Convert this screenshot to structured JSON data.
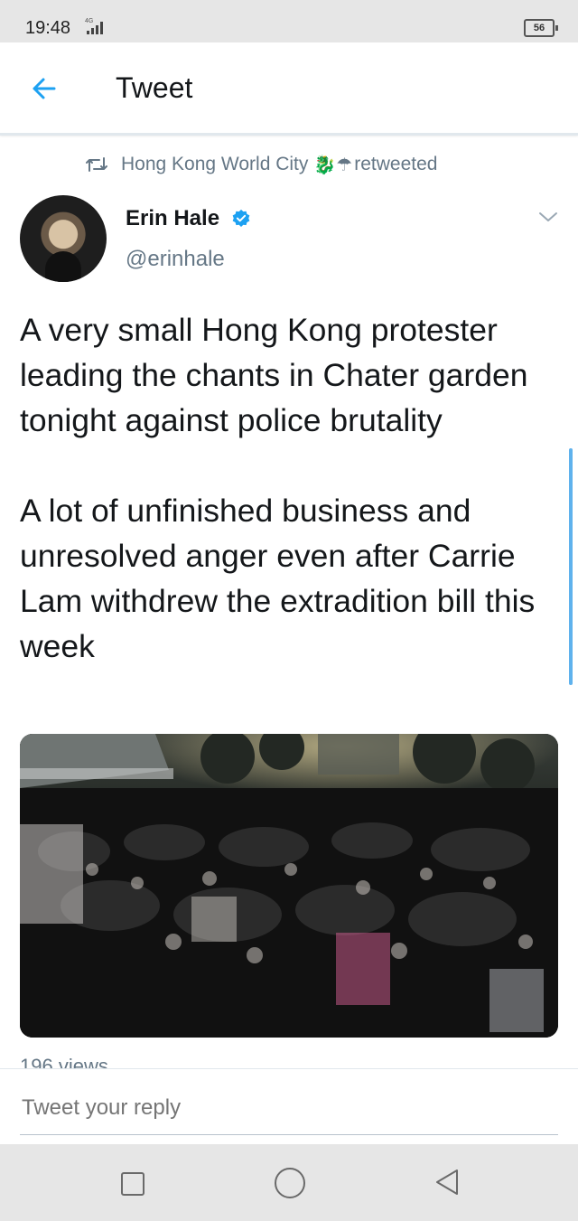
{
  "status_bar": {
    "time": "19:48",
    "battery": "56"
  },
  "header": {
    "title": "Tweet"
  },
  "retweet": {
    "by": "Hong Kong World City",
    "emojis": "🐉☂",
    "suffix": "retweeted"
  },
  "author": {
    "name": "Erin Hale",
    "handle": "@erinhale",
    "verified": true
  },
  "tweet": {
    "text": "A very small Hong Kong protester leading the chants in Chater garden tonight against police brutality\n\nA lot of unfinished business and unresolved anger even after Carrie Lam withdrew the extradition bill this week"
  },
  "media": {
    "type": "video"
  },
  "stats": {
    "views": "196 views"
  },
  "reply": {
    "placeholder": "Tweet your reply"
  },
  "colors": {
    "accent": "#1da1f2",
    "muted": "#657786"
  },
  "icons": [
    "back-arrow-icon",
    "retweet-icon",
    "verified-badge-icon",
    "chevron-down-icon"
  ]
}
